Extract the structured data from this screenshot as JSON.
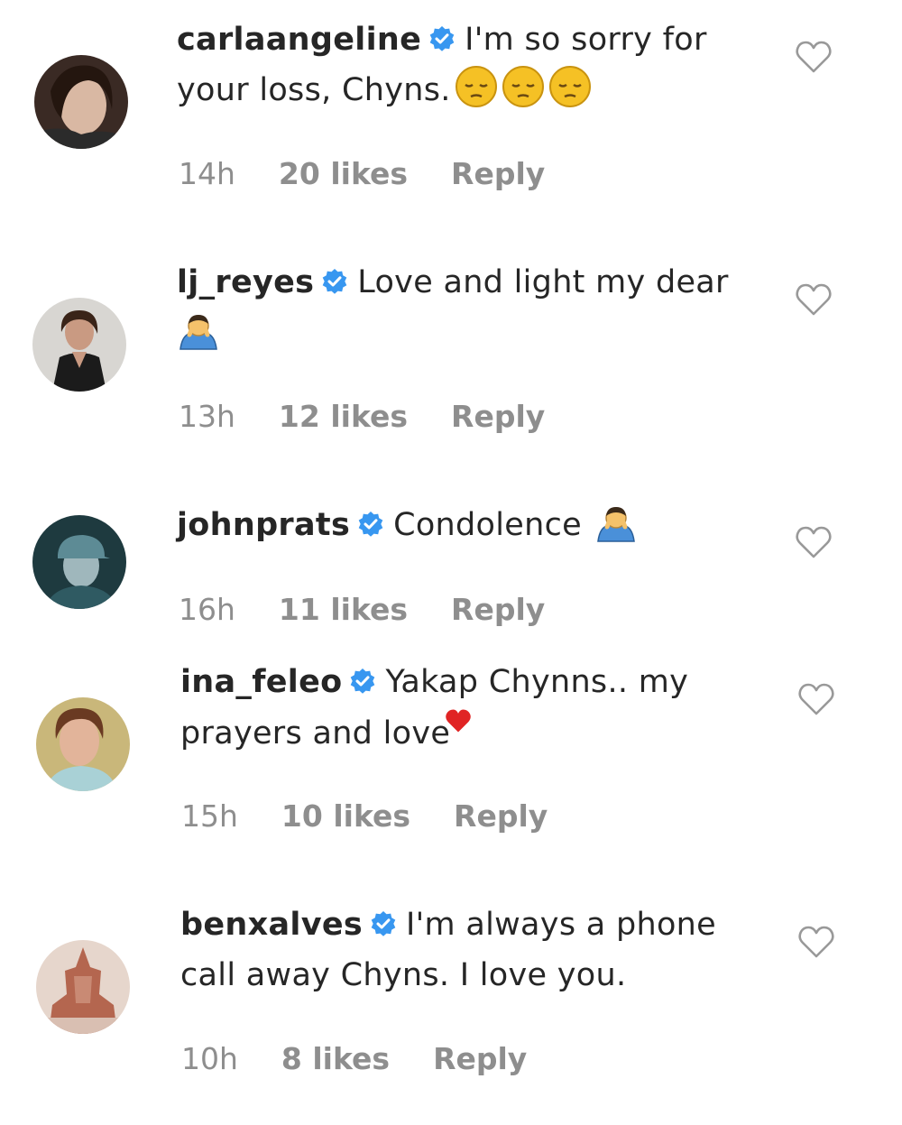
{
  "comments": [
    {
      "username": "carlaangeline",
      "text": "I'm so sorry for your loss, Chyns.",
      "emoji": "pensive-face x3",
      "time": "14h",
      "likes": "20 likes",
      "reply": "Reply"
    },
    {
      "username": "lj_reyes",
      "text": "Love and light my dear",
      "emoji": "person-bowing",
      "time": "13h",
      "likes": "12 likes",
      "reply": "Reply"
    },
    {
      "username": "johnprats",
      "text": "Condolence",
      "emoji": "person-bowing",
      "time": "16h",
      "likes": "11 likes",
      "reply": "Reply"
    },
    {
      "username": "ina_feleo",
      "text": "Yakap Chynns.. my prayers and love",
      "emoji": "red-heart",
      "time": "15h",
      "likes": "10 likes",
      "reply": "Reply"
    },
    {
      "username": "benxalves",
      "text": "I'm always a phone call away Chyns. I love you.",
      "time": "10h",
      "likes": "8 likes",
      "reply": "Reply"
    }
  ],
  "colors": {
    "verified": "#3897f0",
    "meta": "#8e8e8e",
    "text": "#262626",
    "heart-outline": "#999999"
  },
  "icons": {
    "verified": "verified-badge-icon",
    "like": "heart-outline-icon"
  }
}
